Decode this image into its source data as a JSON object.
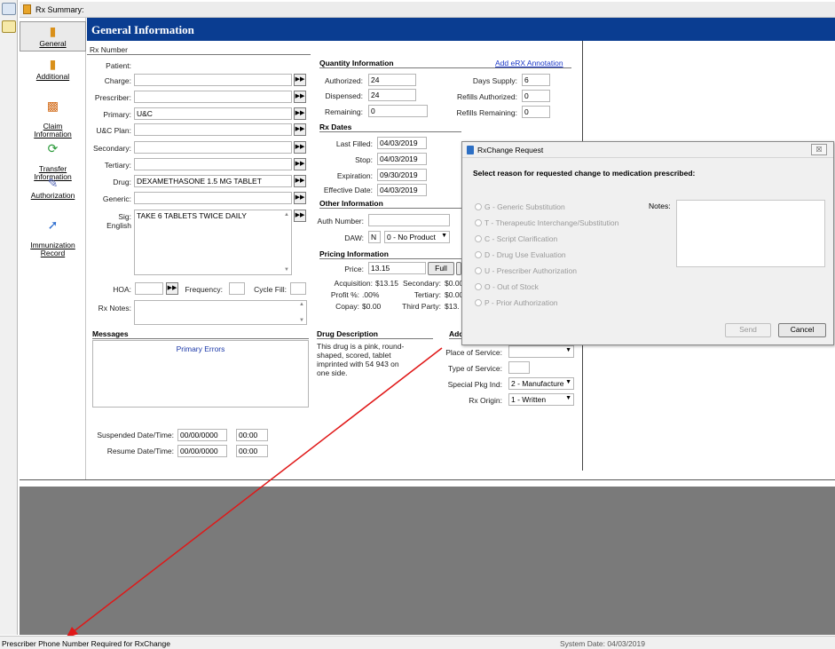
{
  "window": {
    "title": "Rx Summary:"
  },
  "nav": {
    "items": [
      {
        "label": "General"
      },
      {
        "label": "Additional"
      },
      {
        "label": "Claim\nInformation"
      },
      {
        "label": "Transfer\nInformation"
      },
      {
        "label": "Authorization"
      },
      {
        "label": "Immunization\nRecord"
      }
    ]
  },
  "header": {
    "title": "General Information"
  },
  "rx": {
    "rx_number_label": "Rx Number",
    "patient_label": "Patient:",
    "charge_label": "Charge:",
    "prescriber_label": "Prescriber:",
    "primary_label": "Primary:",
    "primary_value": "U&C",
    "uc_plan_label": "U&C Plan:",
    "secondary_label": "Secondary:",
    "tertiary_label": "Tertiary:",
    "drug_label": "Drug:",
    "drug_value": "DEXAMETHASONE 1.5 MG TABLET",
    "generic_label": "Generic:",
    "sig_label": "Sig:",
    "sig_lang": "English",
    "sig_value": "TAKE 6 TABLETS TWICE DAILY",
    "hoa_label": "HOA:",
    "frequency_label": "Frequency:",
    "cycle_fill_label": "Cycle Fill:",
    "rx_notes_label": "Rx Notes:"
  },
  "quantity": {
    "title": "Quantity Information",
    "erx_link": "Add eRX Annotation",
    "authorized_label": "Authorized:",
    "authorized": "24",
    "dispensed_label": "Dispensed:",
    "dispensed": "24",
    "remaining_label": "Remaining:",
    "remaining": "0",
    "days_supply_label": "Days Supply:",
    "days_supply": "6",
    "refills_auth_label": "Refills Authorized:",
    "refills_auth": "0",
    "refills_rem_label": "Refills Remaining:",
    "refills_rem": "0"
  },
  "dates": {
    "title": "Rx Dates",
    "last_filled_label": "Last Filled:",
    "last_filled": "04/03/2019",
    "stop_label": "Stop:",
    "stop": "04/03/2019",
    "expiration_label": "Expiration:",
    "expiration": "09/30/2019",
    "effective_label": "Effective Date:",
    "effective": "04/03/2019"
  },
  "other": {
    "title": "Other Information",
    "auth_number_label": "Auth Number:",
    "daw_label": "DAW:",
    "daw_value": "N",
    "daw_product": "0 - No Product"
  },
  "pricing": {
    "title": "Pricing Information",
    "price_label": "Price:",
    "price": "13.15",
    "full_button": "Full",
    "acquisition_label": "Acquisition:",
    "acquisition": "$13.15",
    "profit_label": "Profit %:",
    "profit": ".00%",
    "copay_label": "Copay:",
    "copay": "$0.00",
    "secondary_label": "Secondary:",
    "secondary": "$0.00",
    "tertiary_label": "Tertiary:",
    "tertiary": "$0.00",
    "third_party_label": "Third Party:",
    "third_party": "$13."
  },
  "messages": {
    "title": "Messages",
    "primary_errors": "Primary Errors"
  },
  "drug_desc": {
    "title": "Drug Description",
    "text": "This drug is a pink, round-shaped, scored, tablet imprinted with 54 943 on one side."
  },
  "additional": {
    "title": "Add",
    "place_label": "Place of Service:",
    "type_label": "Type of Service:",
    "special_label": "Special Pkg Ind:",
    "special_value": "2 - Manufacture",
    "origin_label": "Rx Origin:",
    "origin_value": "1 - Written"
  },
  "suspended": {
    "suspended_label": "Suspended Date/Time:",
    "suspended_date": "00/00/0000",
    "suspended_time": "00:00",
    "resume_label": "Resume Date/Time:",
    "resume_date": "00/00/0000",
    "resume_time": "00:00"
  },
  "dialog": {
    "title": "RxChange Request",
    "close": "☒",
    "prompt": "Select reason for requested change to medication prescribed:",
    "notes_label": "Notes:",
    "options": [
      {
        "label": "G - Generic Substitution"
      },
      {
        "label": "T - Therapeutic Interchange/Substitution"
      },
      {
        "label": "C - Script Clarification"
      },
      {
        "label": "D - Drug Use Evaluation"
      },
      {
        "label": "U - Prescriber Authorization"
      },
      {
        "label": "O - Out of Stock"
      },
      {
        "label": "P - Prior Authorization"
      }
    ],
    "send_button": "Send",
    "cancel_button": "Cancel"
  },
  "status": {
    "message": "Prescriber Phone Number Required for RxChange",
    "system_date": "System Date: 04/03/2019"
  },
  "colors": {
    "header_bg": "#0a3d91",
    "link": "#1a37c8",
    "arrow": "#e01818",
    "grey_area": "#7a7a7a"
  }
}
